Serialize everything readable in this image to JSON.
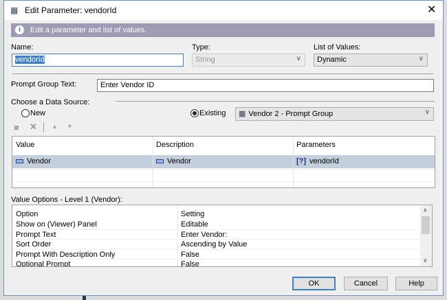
{
  "title": "Edit Parameter: vendorId",
  "info": "Edit a parameter and list of values.",
  "name": {
    "label": "Name:",
    "value": "vendorId"
  },
  "type": {
    "label": "Type:",
    "value": "String"
  },
  "lov": {
    "label": "List of Values:",
    "value": "Dynamic"
  },
  "prompt_group": {
    "label": "Prompt Group Text:",
    "value": "Enter Vendor ID"
  },
  "data_source": {
    "label": "Choose a Data Source:",
    "new_label": "New",
    "existing_label": "Existing",
    "selected": "Existing",
    "existing_value": "Vendor 2 - Prompt Group"
  },
  "values_grid": {
    "headers": [
      "Value",
      "Description",
      "Parameters"
    ],
    "rows": [
      [
        "Vendor",
        "Vendor",
        "vendorId"
      ]
    ],
    "param_icon": "[?]"
  },
  "options": {
    "label": "Value Options - Level 1 (Vendor):",
    "headers": [
      "Option",
      "Setting"
    ],
    "rows": [
      [
        "Show on (Viewer) Panel",
        "Editable"
      ],
      [
        "Prompt Text",
        "Enter Vendor:"
      ],
      [
        "Sort Order",
        "Ascending by Value"
      ],
      [
        "Prompt With Description Only",
        "False"
      ],
      [
        "Optional Prompt",
        "False"
      ]
    ]
  },
  "buttons": {
    "ok": "OK",
    "cancel": "Cancel",
    "help": "Help"
  }
}
